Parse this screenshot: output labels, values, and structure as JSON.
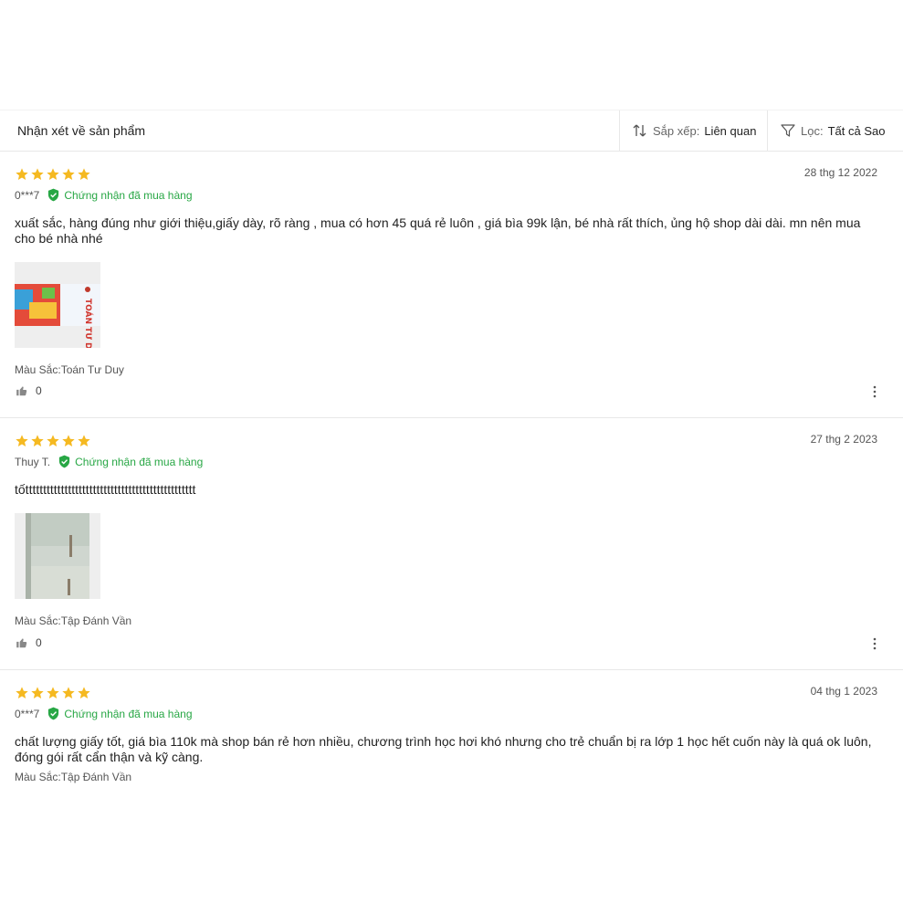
{
  "header": {
    "title": "Nhận xét về sản phẩm",
    "sort_label": "Sắp xếp:",
    "sort_value": "Liên quan",
    "filter_label": "Lọc:",
    "filter_value": "Tất cả Sao"
  },
  "colors": {
    "star": "#f5b921",
    "verified": "#28a745",
    "divider": "#e8e8e8"
  },
  "reviews": [
    {
      "rating": 5,
      "date": "28 thg 12 2022",
      "user": "0***7",
      "verified_text": "Chứng nhận đã mua hàng",
      "text": "xuất sắc, hàng đúng như giới thiệu,giấy dày, rõ ràng , mua có hơn 45 quá rẻ luôn , giá bìa 99k lận, bé nhà rất thích, ủng hộ shop dài dài. mn nên mua cho bé nhà nhé",
      "variant": "Màu Sắc:Toán Tư Duy",
      "likes": "0",
      "image_text": "TOÁN TƯ DUY"
    },
    {
      "rating": 5,
      "date": "27 thg 2 2023",
      "user": "Thuy T.",
      "verified_text": "Chứng nhận đã mua hàng",
      "text": "tốtttttttttttttttttttttttttttttttttttttttttttttttt",
      "variant": "Màu Sắc:Tập Đánh Vần",
      "likes": "0"
    },
    {
      "rating": 5,
      "date": "04 thg 1 2023",
      "user": "0***7",
      "verified_text": "Chứng nhận đã mua hàng",
      "text": "chất lượng giấy tốt, giá bìa 110k mà shop bán rẻ hơn nhiều,  chương trình học hơi khó nhưng cho trẻ chuẩn bị ra lớp 1 học hết cuốn này là quá ok luôn, đóng gói rất cẩn thận và kỹ càng.",
      "variant": "Màu Sắc:Tập Đánh Vần"
    }
  ]
}
